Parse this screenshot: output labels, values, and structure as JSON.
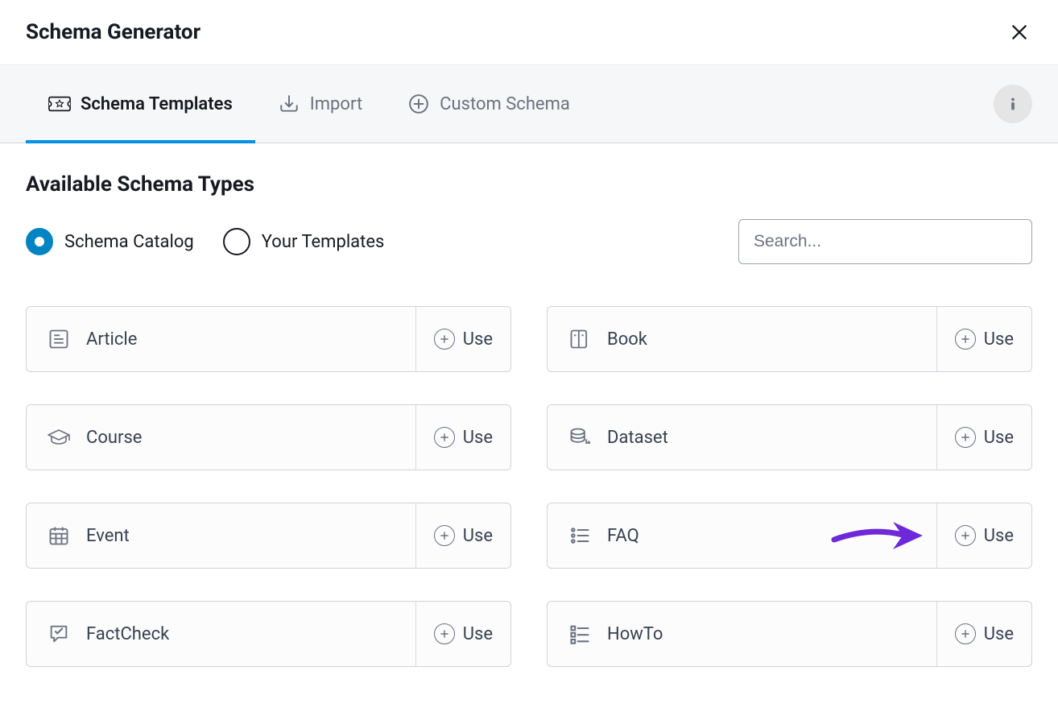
{
  "header": {
    "title": "Schema Generator"
  },
  "tabs": [
    {
      "label": "Schema Templates",
      "icon": "ticket-star-icon",
      "active": true
    },
    {
      "label": "Import",
      "icon": "download-icon",
      "active": false
    },
    {
      "label": "Custom Schema",
      "icon": "plus-circle-icon",
      "active": false
    }
  ],
  "section_title": "Available Schema Types",
  "radios": [
    {
      "label": "Schema Catalog",
      "selected": true
    },
    {
      "label": "Your Templates",
      "selected": false
    }
  ],
  "search": {
    "placeholder": "Search..."
  },
  "use_label": "Use",
  "schema_types": [
    {
      "label": "Article",
      "icon": "article-icon"
    },
    {
      "label": "Book",
      "icon": "book-icon"
    },
    {
      "label": "Course",
      "icon": "course-icon"
    },
    {
      "label": "Dataset",
      "icon": "dataset-icon"
    },
    {
      "label": "Event",
      "icon": "event-icon"
    },
    {
      "label": "FAQ",
      "icon": "faq-icon",
      "highlighted": true
    },
    {
      "label": "FactCheck",
      "icon": "factcheck-icon"
    },
    {
      "label": "HowTo",
      "icon": "howto-icon"
    }
  ],
  "annotation": {
    "arrow_color": "#6d28d9"
  }
}
